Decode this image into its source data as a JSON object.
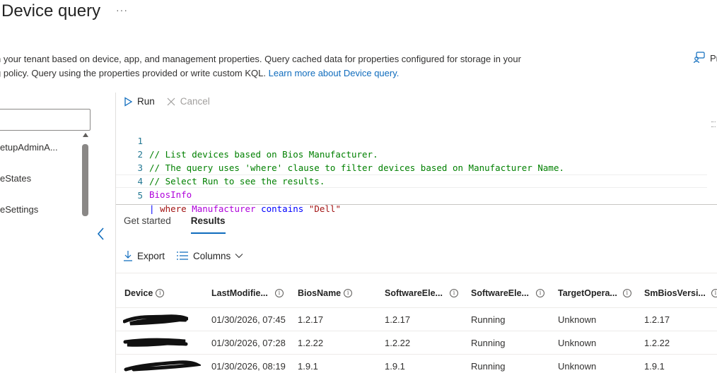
{
  "header": {
    "title": "Device query",
    "more": "···",
    "description_line1": "n your tenant based on device, app, and management properties. Query cached data for properties configured for storage in your",
    "description_line2_text": "g policy. Query using the properties provided or write custom KQL. ",
    "description_link": "Learn more about Device query.",
    "feedback_label": "Pr"
  },
  "sidebar": {
    "items": [
      {
        "label": "etupAdminA..."
      },
      {
        "label": "eStates"
      },
      {
        "label": "eSettings"
      }
    ]
  },
  "toolbar": {
    "run_label": "Run",
    "cancel_label": "Cancel"
  },
  "editor": {
    "lines": [
      {
        "num": "1",
        "text": "// List devices based on Bios Manufacturer."
      },
      {
        "num": "2",
        "text": "// The query uses 'where' clause to filter devices based on Manufacturer Name."
      },
      {
        "num": "3",
        "text": "// Select Run to see the results."
      },
      {
        "num": "4",
        "text": "BiosInfo"
      },
      {
        "num": "5",
        "pipe": "|",
        "kw": "where",
        "col": "Manufacturer",
        "op": "contains",
        "str": "\"Dell\""
      }
    ]
  },
  "tabs": [
    {
      "label": "Get started",
      "active": false
    },
    {
      "label": "Results",
      "active": true
    }
  ],
  "results_toolbar": {
    "export_label": "Export",
    "columns_label": "Columns"
  },
  "table": {
    "columns": [
      "Device",
      "LastModifie...",
      "BiosName",
      "SoftwareEle...",
      "SoftwareEle...",
      "TargetOpera...",
      "SmBiosVersi..."
    ],
    "rows": [
      [
        "",
        "01/30/2026, 07:45",
        "1.2.17",
        "1.2.17",
        "Running",
        "Unknown",
        "1.2.17"
      ],
      [
        "",
        "01/30/2026, 07:28",
        "1.2.22",
        "1.2.22",
        "Running",
        "Unknown",
        "1.2.22"
      ],
      [
        "",
        "01/30/2026, 08:19",
        "1.9.1",
        "1.9.1",
        "Running",
        "Unknown",
        "1.9.1"
      ]
    ]
  },
  "colors": {
    "accent": "#0f6cbd",
    "comment": "#008000",
    "keyword": "#af00db"
  }
}
